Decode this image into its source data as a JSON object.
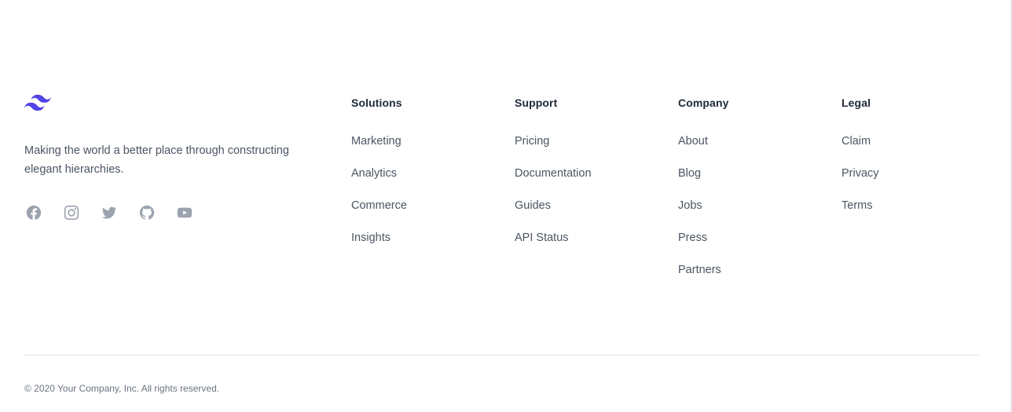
{
  "brand": {
    "logo_icon": "tailwind-wave-icon",
    "logo_color": "#5145e5",
    "tagline": "Making the world a better place through constructing elegant hierarchies."
  },
  "socials": [
    {
      "name": "Facebook",
      "icon": "facebook-icon"
    },
    {
      "name": "Instagram",
      "icon": "instagram-icon"
    },
    {
      "name": "Twitter",
      "icon": "twitter-icon"
    },
    {
      "name": "GitHub",
      "icon": "github-icon"
    },
    {
      "name": "YouTube",
      "icon": "youtube-icon"
    }
  ],
  "columns": {
    "solutions": {
      "title": "Solutions",
      "links": [
        "Marketing",
        "Analytics",
        "Commerce",
        "Insights"
      ]
    },
    "support": {
      "title": "Support",
      "links": [
        "Pricing",
        "Documentation",
        "Guides",
        "API Status"
      ]
    },
    "company": {
      "title": "Company",
      "links": [
        "About",
        "Blog",
        "Jobs",
        "Press",
        "Partners"
      ]
    },
    "legal": {
      "title": "Legal",
      "links": [
        "Claim",
        "Privacy",
        "Terms"
      ]
    }
  },
  "copyright": "© 2020 Your Company, Inc. All rights reserved.",
  "colors": {
    "heading": "#1f2937",
    "text": "#4b5563",
    "icon": "#9ca3af",
    "divider": "#e5e7eb"
  }
}
